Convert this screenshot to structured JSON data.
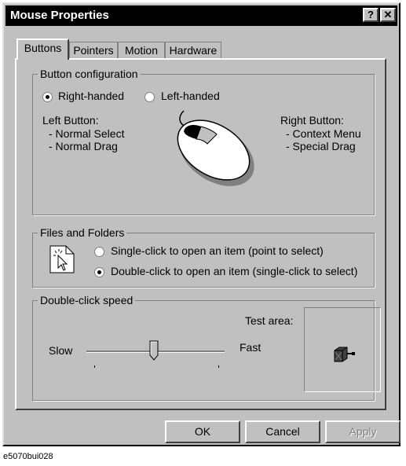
{
  "window": {
    "title": "Mouse Properties",
    "help_glyph": "?",
    "close_glyph": "✕"
  },
  "tabs": [
    "Buttons",
    "Pointers",
    "Motion",
    "Hardware"
  ],
  "button_config": {
    "legend": "Button configuration",
    "right_handed": "Right-handed",
    "left_handed": "Left-handed",
    "selected": "right",
    "left_button_title": "Left Button:",
    "left_items": [
      "- Normal Select",
      "- Normal Drag"
    ],
    "right_button_title": "Right Button:",
    "right_items": [
      "- Context Menu",
      "- Special Drag"
    ]
  },
  "files_folders": {
    "legend": "Files and Folders",
    "single_click": "Single-click to open an item (point to select)",
    "double_click": "Double-click to open an item (single-click to select)",
    "selected": "double"
  },
  "double_click_speed": {
    "legend": "Double-click speed",
    "slow": "Slow",
    "fast": "Fast",
    "test_area": "Test area:",
    "slider_position": 0.49
  },
  "buttons": {
    "ok": "OK",
    "cancel": "Cancel",
    "apply": "Apply"
  },
  "caption": "e5070bui028"
}
